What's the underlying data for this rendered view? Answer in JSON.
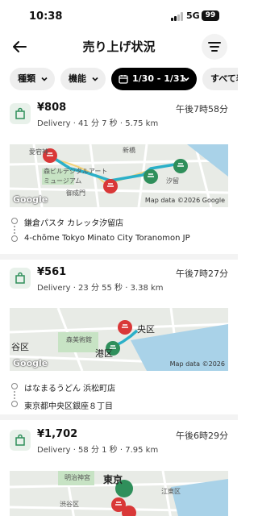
{
  "status_bar": {
    "time": "10:38",
    "network": "5G",
    "battery": "99"
  },
  "header": {
    "title": "売り上げ状況"
  },
  "chips": [
    {
      "label": "種類"
    },
    {
      "label": "機能"
    },
    {
      "label": "1/30 - 1/31"
    },
    {
      "label": "すべて表"
    }
  ],
  "trips": [
    {
      "fare": "¥808",
      "time": "午後7時58分",
      "meta": "Delivery · 41 分 7 秒 · 5.75 km",
      "map_labels": [
        "愛宕神",
        "新橋",
        "森ビルデジタルアート",
        "ミュージアム",
        "御成門",
        "汐留"
      ],
      "map_attribution": "Map data ©2026 Google",
      "google_logo": "Google",
      "pickup": "鎌倉パスタ カレッタ汐留店",
      "dropoff": "4-chōme Tokyo Minato City Toranomon JP"
    },
    {
      "fare": "¥561",
      "time": "午後7時27分",
      "meta": "Delivery · 23 分 55 秒 · 3.38 km",
      "map_labels": [
        "央区",
        "森美術館",
        "港区",
        "谷区"
      ],
      "map_attribution": "Map data ©2026",
      "google_logo": "Google",
      "pickup": "はなまるうどん 浜松町店",
      "dropoff": "東京都中央区銀座８丁目"
    },
    {
      "fare": "¥1,702",
      "time": "午後6時29分",
      "meta": "Delivery · 58 分 1 秒 · 7.95 km",
      "map_labels": [
        "明治神宮",
        "東京",
        "江東区",
        "渋谷区"
      ]
    }
  ],
  "colors": {
    "pin_red": "#d93838",
    "pin_green": "#2f8f5b",
    "route": "#2bb0c8",
    "chip_dark": "#000000"
  }
}
